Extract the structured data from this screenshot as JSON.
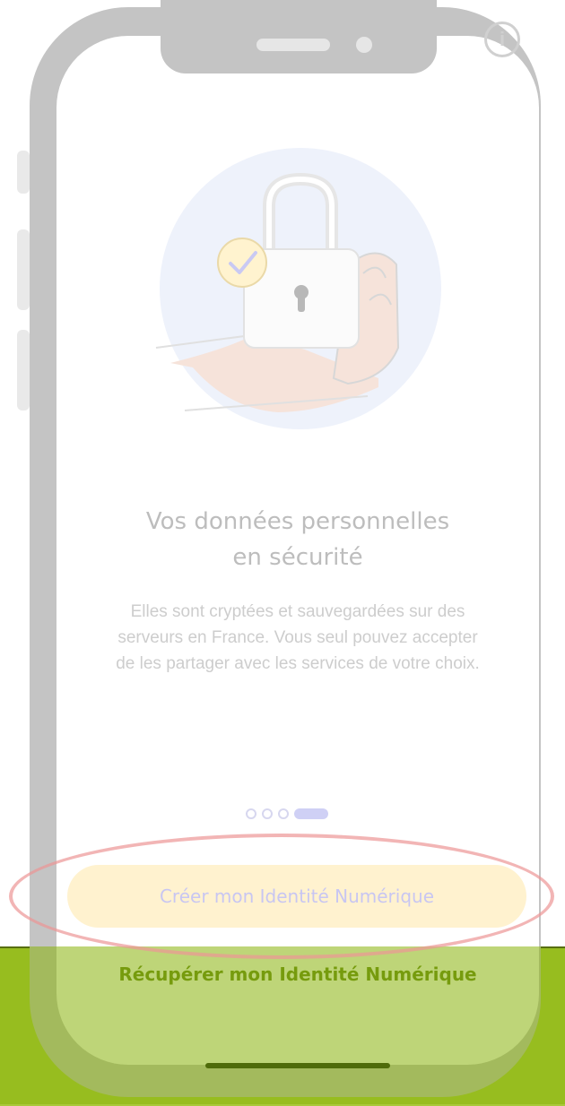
{
  "icons": {
    "info": "info-icon",
    "illustration": "padlock-in-hand-illustration",
    "check": "check-icon"
  },
  "onboarding": {
    "title": "Vos données personnelles\nen sécurité",
    "description": "Elles sont cryptées et sauvegardées sur des\nserveurs en France. Vous seul pouvez accepter\nde les partager avec les services de votre choix.",
    "pager": {
      "total": 4,
      "current": 4
    }
  },
  "actions": {
    "create_label": "Créer mon Identité Numérique",
    "recover_label": "Récupérer mon Identité Numérique"
  },
  "colors": {
    "primary_button": "#fff2cf",
    "accent": "#cfd0f5",
    "overlay_green": "#a9c93a",
    "highlight_ring": "#ec9696"
  }
}
